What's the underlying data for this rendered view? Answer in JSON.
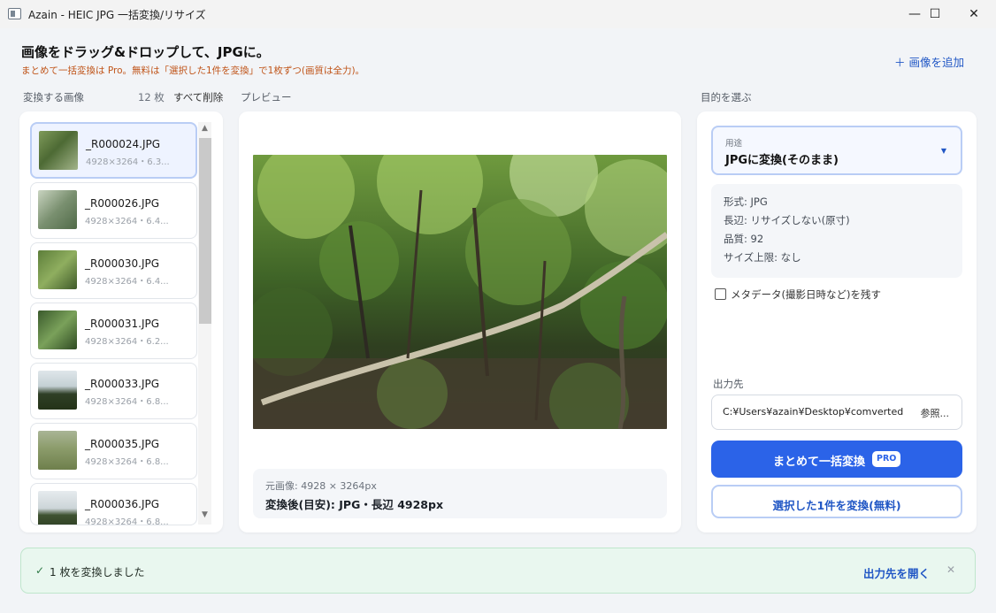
{
  "window": {
    "title": "Azain - HEIC JPG 一括変換/リサイズ",
    "minimize_glyph": "—",
    "maximize_glyph": "☐",
    "close_glyph": "✕"
  },
  "header": {
    "title": "画像をドラッグ&ドロップして、JPGに。",
    "note": "まとめて一括変換は Pro。無料は「選択した1件を変換」で1枚ずつ(画質は全力)。",
    "add_button": "＋ 画像を追加"
  },
  "file_list": {
    "label": "変換する画像",
    "count": "12 枚",
    "clear_all": "すべて削除",
    "items": [
      {
        "name": "_R000024.JPG",
        "meta": "4928×3264・6.3...",
        "selected": true
      },
      {
        "name": "_R000026.JPG",
        "meta": "4928×3264・6.4..."
      },
      {
        "name": "_R000030.JPG",
        "meta": "4928×3264・6.4..."
      },
      {
        "name": "_R000031.JPG",
        "meta": "4928×3264・6.2..."
      },
      {
        "name": "_R000033.JPG",
        "meta": "4928×3264・6.8..."
      },
      {
        "name": "_R000035.JPG",
        "meta": "4928×3264・6.8..."
      },
      {
        "name": "_R000036.JPG",
        "meta": "4928×3264・6.8..."
      }
    ],
    "scroll_up": "▲",
    "scroll_down": "▼"
  },
  "preview": {
    "label": "プレビュー",
    "original": "元画像: 4928 × 3264px",
    "converted": "変換後(目安): JPG・長辺 4928px"
  },
  "purpose": {
    "label": "目的を選ぶ",
    "dropdown_caption": "用途",
    "dropdown_value": "JPGに変換(そのまま)",
    "dropdown_arrow": "▼",
    "format": "形式: JPG",
    "long_edge": "長辺: リサイズしない(原寸)",
    "quality": "品質: 92",
    "size_limit": "サイズ上限: なし",
    "metadata_label": "メタデータ(撮影日時など)を残す",
    "metadata_checked": false,
    "output_label": "出力先",
    "output_path": "C:¥Users¥azain¥Desktop¥comverted",
    "browse": "参照...",
    "batch_button": "まとめて一括変換",
    "pro_badge": "PRO",
    "single_button": "選択した1件を変換(無料)"
  },
  "toast": {
    "check": "✓",
    "message": "1 枚を変換しました",
    "open_output": "出力先を開く",
    "close": "✕"
  },
  "colors": {
    "accent": "#2b63e8",
    "link": "#2157c5",
    "warning_text": "#c0551a",
    "success_bg": "#e9f7ef"
  }
}
